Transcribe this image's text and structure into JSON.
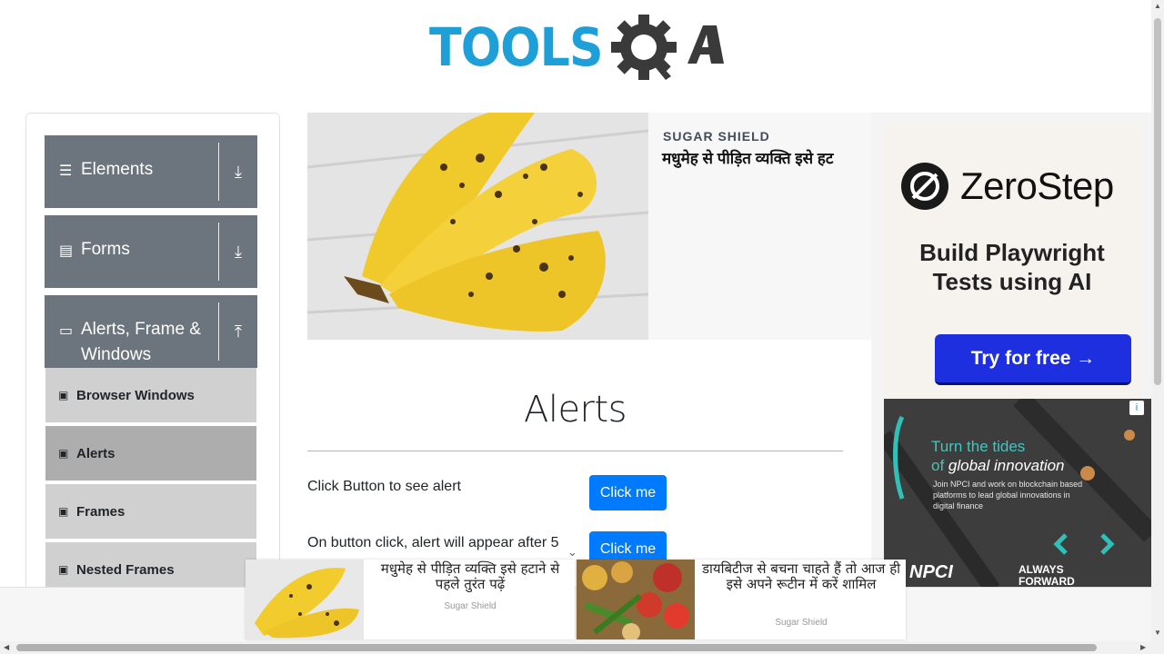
{
  "header": {
    "logo_text": "TOOLS",
    "logo_suffix": "QA"
  },
  "sidebar": {
    "groups": [
      {
        "label": "Elements",
        "icon": "list-icon",
        "arrow": "download-arrow-icon"
      },
      {
        "label": "Forms",
        "icon": "document-icon",
        "arrow": "download-arrow-icon"
      },
      {
        "label": "Alerts, Frame & Windows",
        "icon": "window-icon",
        "arrow": "upload-arrow-icon"
      }
    ],
    "items": [
      {
        "label": "Browser Windows",
        "active": false
      },
      {
        "label": "Alerts",
        "active": true
      },
      {
        "label": "Frames",
        "active": false
      },
      {
        "label": "Nested Frames",
        "active": false
      }
    ]
  },
  "top_ad": {
    "brand": "SUGAR SHIELD",
    "headline": "मधुमेह से पीड़ित व्यक्ति इसे हट"
  },
  "right_ad": {
    "zerostep_name": "ZeroStep",
    "zerostep_tagline_1": "Build Playwright",
    "zerostep_tagline_2": "Tests using AI",
    "zerostep_button": "Try for free →",
    "npci_title_1": "Turn the tides",
    "npci_title_2_prefix": "of ",
    "npci_title_2_em": "global innovation",
    "npci_body": "Join NPCI and work on blockchain based platforms to lead global innovations in digital finance",
    "npci_logo": "NPCI",
    "npci_forward_1": "ALWAYS",
    "npci_forward_2": "FORWARD",
    "adchoice": "i"
  },
  "main": {
    "title": "Alerts",
    "rows": [
      {
        "label": "Click Button to see alert",
        "button": "Click me"
      },
      {
        "label": "On button click, alert will appear after 5",
        "button": "Click me"
      }
    ]
  },
  "bottom_ads": [
    {
      "text": "मधुमेह से पीड़ित व्यक्ति इसे हटाने से पहले तुरंत पढ़ें",
      "source": "Sugar Shield"
    },
    {
      "text": "डायबिटीज से बचना चाहते हैं तो आज ही इसे अपने रूटीन में करें शामिल",
      "source": "Sugar Shield"
    }
  ],
  "colors": {
    "brand_blue": "#1e9fd8",
    "sidebar_group": "#6c757d",
    "button_primary": "#007bff",
    "zerostep_button": "#1e2fe0"
  }
}
